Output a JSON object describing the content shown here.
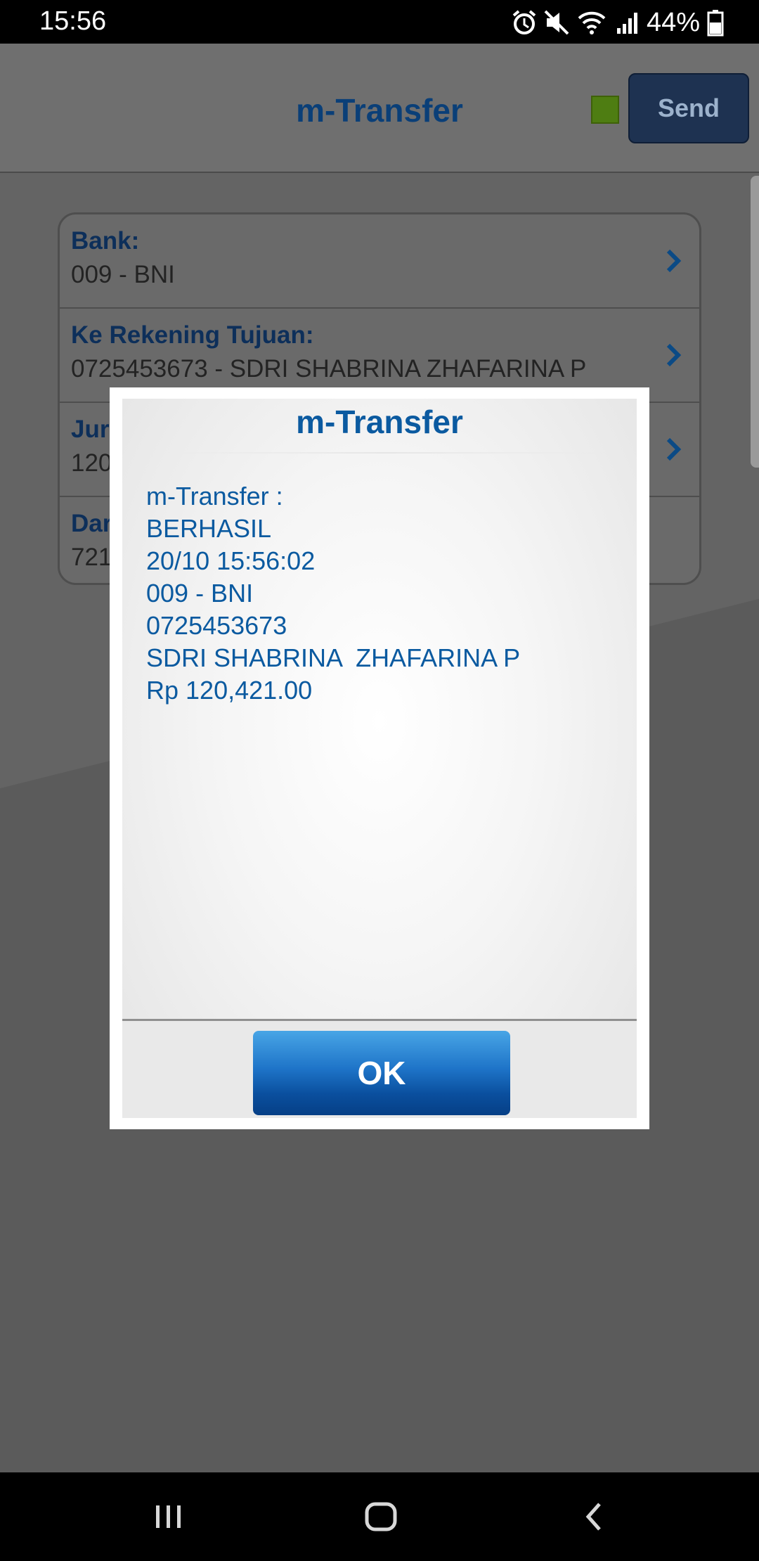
{
  "status_bar": {
    "time": "15:56",
    "battery": "44%",
    "icons": [
      "alarm-icon",
      "mute-icon",
      "wifi-icon",
      "signal-icon",
      "battery-icon"
    ]
  },
  "header": {
    "title": "m-Transfer",
    "send_label": "Send",
    "indicator_color": "#4e7d12"
  },
  "form": {
    "rows": [
      {
        "label": "Bank:",
        "value": "009 - BNI"
      },
      {
        "label": "Ke Rekening Tujuan:",
        "value": "0725453673 - SDRI SHABRINA  ZHAFARINA P"
      },
      {
        "label": "Jur",
        "value": "120"
      },
      {
        "label": "Dar",
        "value": "721"
      }
    ]
  },
  "dialog": {
    "title": "m-Transfer",
    "lines": [
      "m-Transfer :",
      "BERHASIL",
      "20/10 15:56:02",
      "009 - BNI",
      "0725453673",
      "SDRI SHABRINA  ZHAFARINA P",
      "Rp 120,421.00"
    ],
    "ok_label": "OK"
  },
  "nav": {
    "icons": [
      "recents-icon",
      "home-icon",
      "back-icon"
    ]
  }
}
